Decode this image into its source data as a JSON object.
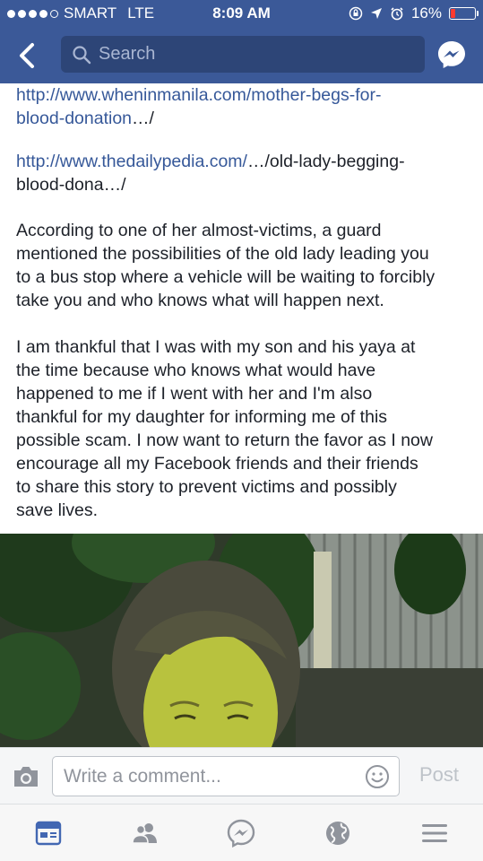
{
  "status_bar": {
    "carrier": "SMART",
    "network": "LTE",
    "time": "8:09 AM",
    "battery": "16%",
    "battery_color": "#ff3b30"
  },
  "nav": {
    "back_icon": "chevron-left-icon",
    "search_placeholder": "Search",
    "messenger_icon": "messenger-icon",
    "bar_color": "#3b5998"
  },
  "post": {
    "link1": {
      "line1": "http://www.wheninmanila.com/mother-begs-for-",
      "line2": "blood-donation",
      "suffix": "…/"
    },
    "link2": {
      "line1_link": "http://www.thedailypedia.com/",
      "line1_rest": "…/old-lady-begging-",
      "line2": "blood-dona…/"
    },
    "paragraph1_lines": [
      "According to one of her almost-victims, a guard",
      "mentioned the possibilities of the old lady leading you",
      "to a bus stop where a vehicle will be waiting to forcibly",
      "take you and who knows what will happen next."
    ],
    "paragraph2_lines": [
      "I am thankful that I was with my son and his yaya at",
      "the time because who knows what would have",
      "happened to me if I went with her and I'm also",
      "thankful for my daughter for informing me of this",
      "possible scam. I now want to return the favor as I now",
      "encourage all my Facebook friends and their friends",
      "to share this story to prevent victims and possibly",
      "save lives."
    ],
    "link_color": "#365899"
  },
  "comment_bar": {
    "camera_icon": "camera-icon",
    "placeholder": "Write a comment...",
    "emoji_icon": "smiley-icon",
    "post_label": "Post"
  },
  "tab_bar": {
    "tabs": [
      "news-feed-icon",
      "friends-icon",
      "messenger-icon",
      "globe-notifications-icon",
      "menu-icon"
    ],
    "active_color": "#4267b2"
  }
}
